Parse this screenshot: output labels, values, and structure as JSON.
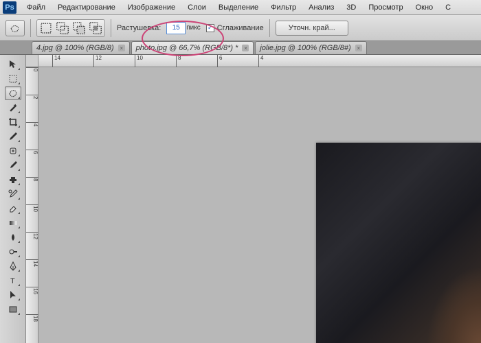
{
  "menu": {
    "items": [
      "Файл",
      "Редактирование",
      "Изображение",
      "Слои",
      "Выделение",
      "Фильтр",
      "Анализ",
      "3D",
      "Просмотр",
      "Окно",
      "С"
    ]
  },
  "options": {
    "feather_label": "Растушевка:",
    "feather_value": "15",
    "feather_unit": "пикс",
    "antialias_label": "Сглаживание",
    "refine_btn": "Уточн. край..."
  },
  "tabs": [
    {
      "label": "4.jpg @ 100% (RGB/8)",
      "active": false
    },
    {
      "label": "photo.jpg @ 66,7% (RGB/8*) *",
      "active": true
    },
    {
      "label": "jolie.jpg @ 100% (RGB/8#)",
      "active": false
    }
  ],
  "ruler_h": [
    "14",
    "12",
    "10",
    "8",
    "6",
    "4"
  ],
  "ruler_v": [
    "0",
    "2",
    "4",
    "6",
    "8",
    "10",
    "12",
    "14",
    "16",
    "18"
  ]
}
